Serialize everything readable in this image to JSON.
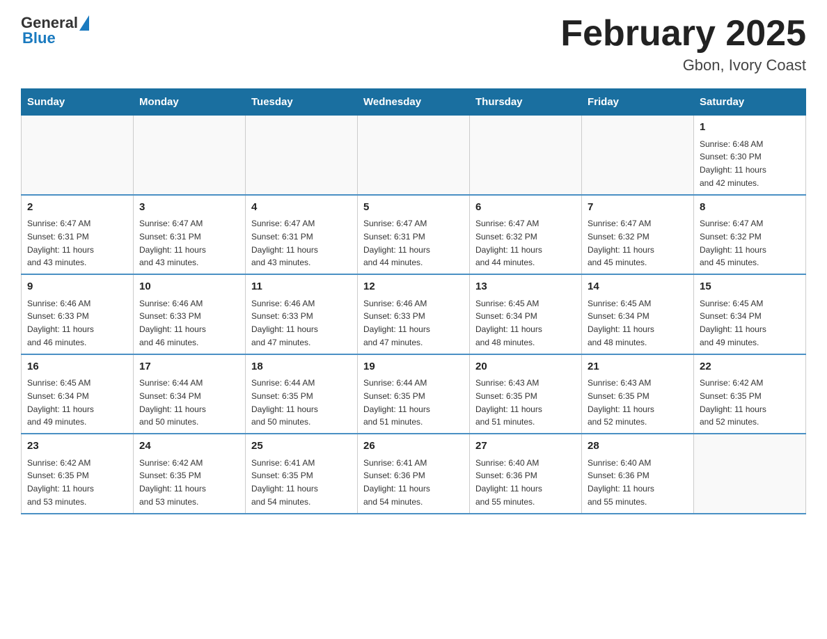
{
  "logo": {
    "general": "General",
    "blue": "Blue"
  },
  "title": "February 2025",
  "subtitle": "Gbon, Ivory Coast",
  "weekdays": [
    "Sunday",
    "Monday",
    "Tuesday",
    "Wednesday",
    "Thursday",
    "Friday",
    "Saturday"
  ],
  "weeks": [
    [
      {
        "day": "",
        "info": ""
      },
      {
        "day": "",
        "info": ""
      },
      {
        "day": "",
        "info": ""
      },
      {
        "day": "",
        "info": ""
      },
      {
        "day": "",
        "info": ""
      },
      {
        "day": "",
        "info": ""
      },
      {
        "day": "1",
        "info": "Sunrise: 6:48 AM\nSunset: 6:30 PM\nDaylight: 11 hours\nand 42 minutes."
      }
    ],
    [
      {
        "day": "2",
        "info": "Sunrise: 6:47 AM\nSunset: 6:31 PM\nDaylight: 11 hours\nand 43 minutes."
      },
      {
        "day": "3",
        "info": "Sunrise: 6:47 AM\nSunset: 6:31 PM\nDaylight: 11 hours\nand 43 minutes."
      },
      {
        "day": "4",
        "info": "Sunrise: 6:47 AM\nSunset: 6:31 PM\nDaylight: 11 hours\nand 43 minutes."
      },
      {
        "day": "5",
        "info": "Sunrise: 6:47 AM\nSunset: 6:31 PM\nDaylight: 11 hours\nand 44 minutes."
      },
      {
        "day": "6",
        "info": "Sunrise: 6:47 AM\nSunset: 6:32 PM\nDaylight: 11 hours\nand 44 minutes."
      },
      {
        "day": "7",
        "info": "Sunrise: 6:47 AM\nSunset: 6:32 PM\nDaylight: 11 hours\nand 45 minutes."
      },
      {
        "day": "8",
        "info": "Sunrise: 6:47 AM\nSunset: 6:32 PM\nDaylight: 11 hours\nand 45 minutes."
      }
    ],
    [
      {
        "day": "9",
        "info": "Sunrise: 6:46 AM\nSunset: 6:33 PM\nDaylight: 11 hours\nand 46 minutes."
      },
      {
        "day": "10",
        "info": "Sunrise: 6:46 AM\nSunset: 6:33 PM\nDaylight: 11 hours\nand 46 minutes."
      },
      {
        "day": "11",
        "info": "Sunrise: 6:46 AM\nSunset: 6:33 PM\nDaylight: 11 hours\nand 47 minutes."
      },
      {
        "day": "12",
        "info": "Sunrise: 6:46 AM\nSunset: 6:33 PM\nDaylight: 11 hours\nand 47 minutes."
      },
      {
        "day": "13",
        "info": "Sunrise: 6:45 AM\nSunset: 6:34 PM\nDaylight: 11 hours\nand 48 minutes."
      },
      {
        "day": "14",
        "info": "Sunrise: 6:45 AM\nSunset: 6:34 PM\nDaylight: 11 hours\nand 48 minutes."
      },
      {
        "day": "15",
        "info": "Sunrise: 6:45 AM\nSunset: 6:34 PM\nDaylight: 11 hours\nand 49 minutes."
      }
    ],
    [
      {
        "day": "16",
        "info": "Sunrise: 6:45 AM\nSunset: 6:34 PM\nDaylight: 11 hours\nand 49 minutes."
      },
      {
        "day": "17",
        "info": "Sunrise: 6:44 AM\nSunset: 6:34 PM\nDaylight: 11 hours\nand 50 minutes."
      },
      {
        "day": "18",
        "info": "Sunrise: 6:44 AM\nSunset: 6:35 PM\nDaylight: 11 hours\nand 50 minutes."
      },
      {
        "day": "19",
        "info": "Sunrise: 6:44 AM\nSunset: 6:35 PM\nDaylight: 11 hours\nand 51 minutes."
      },
      {
        "day": "20",
        "info": "Sunrise: 6:43 AM\nSunset: 6:35 PM\nDaylight: 11 hours\nand 51 minutes."
      },
      {
        "day": "21",
        "info": "Sunrise: 6:43 AM\nSunset: 6:35 PM\nDaylight: 11 hours\nand 52 minutes."
      },
      {
        "day": "22",
        "info": "Sunrise: 6:42 AM\nSunset: 6:35 PM\nDaylight: 11 hours\nand 52 minutes."
      }
    ],
    [
      {
        "day": "23",
        "info": "Sunrise: 6:42 AM\nSunset: 6:35 PM\nDaylight: 11 hours\nand 53 minutes."
      },
      {
        "day": "24",
        "info": "Sunrise: 6:42 AM\nSunset: 6:35 PM\nDaylight: 11 hours\nand 53 minutes."
      },
      {
        "day": "25",
        "info": "Sunrise: 6:41 AM\nSunset: 6:35 PM\nDaylight: 11 hours\nand 54 minutes."
      },
      {
        "day": "26",
        "info": "Sunrise: 6:41 AM\nSunset: 6:36 PM\nDaylight: 11 hours\nand 54 minutes."
      },
      {
        "day": "27",
        "info": "Sunrise: 6:40 AM\nSunset: 6:36 PM\nDaylight: 11 hours\nand 55 minutes."
      },
      {
        "day": "28",
        "info": "Sunrise: 6:40 AM\nSunset: 6:36 PM\nDaylight: 11 hours\nand 55 minutes."
      },
      {
        "day": "",
        "info": ""
      }
    ]
  ]
}
